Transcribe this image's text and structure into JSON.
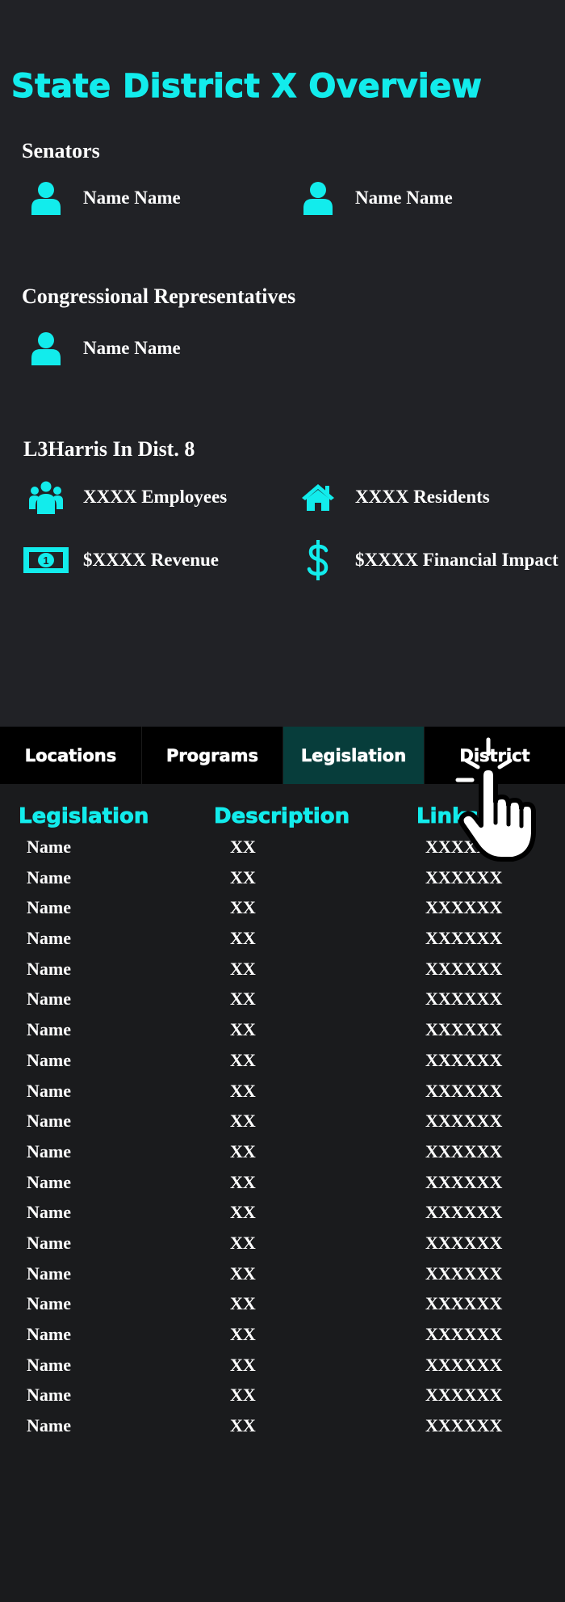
{
  "overview": {
    "title": "State District X Overview"
  },
  "senators": {
    "heading": "Senators",
    "members": [
      {
        "name": "Name Name",
        "icon": "user-icon"
      },
      {
        "name": "Name Name",
        "icon": "user-icon"
      }
    ]
  },
  "congress": {
    "heading": "Congressional Representatives",
    "members": [
      {
        "name": "Name Name",
        "icon": "user-icon"
      }
    ]
  },
  "company": {
    "heading": "L3Harris In Dist. 8",
    "stats": [
      {
        "label": "XXXX Employees",
        "icon": "users-icon"
      },
      {
        "label": "XXXX Residents",
        "icon": "home-icon"
      },
      {
        "label": "$XXXX Revenue",
        "icon": "money-bill-icon"
      },
      {
        "label": "$XXXX Financial Impact",
        "icon": "dollar-icon"
      }
    ]
  },
  "tabs": [
    {
      "label": "Locations",
      "active": false
    },
    {
      "label": "Programs",
      "active": false
    },
    {
      "label": "Legislation",
      "active": true
    },
    {
      "label": "District",
      "active": false
    }
  ],
  "legislation_table": {
    "headers": [
      "Legislation",
      "Description",
      "Links"
    ],
    "rows": [
      [
        "Name",
        "XX",
        "XXXXXX"
      ],
      [
        "Name",
        "XX",
        "XXXXXX"
      ],
      [
        "Name",
        "XX",
        "XXXXXX"
      ],
      [
        "Name",
        "XX",
        "XXXXXX"
      ],
      [
        "Name",
        "XX",
        "XXXXXX"
      ],
      [
        "Name",
        "XX",
        "XXXXXX"
      ],
      [
        "Name",
        "XX",
        "XXXXXX"
      ],
      [
        "Name",
        "XX",
        "XXXXXX"
      ],
      [
        "Name",
        "XX",
        "XXXXXX"
      ],
      [
        "Name",
        "XX",
        "XXXXXX"
      ],
      [
        "Name",
        "XX",
        "XXXXXX"
      ],
      [
        "Name",
        "XX",
        "XXXXXX"
      ],
      [
        "Name",
        "XX",
        "XXXXXX"
      ],
      [
        "Name",
        "XX",
        "XXXXXX"
      ],
      [
        "Name",
        "XX",
        "XXXXXX"
      ],
      [
        "Name",
        "XX",
        "XXXXXX"
      ],
      [
        "Name",
        "XX",
        "XXXXXX"
      ],
      [
        "Name",
        "XX",
        "XXXXXX"
      ],
      [
        "Name",
        "XX",
        "XXXXXX"
      ],
      [
        "Name",
        "XX",
        "XXXXXX"
      ]
    ]
  },
  "colors": {
    "accent": "#12ecec",
    "active_tab": "#073d3b",
    "panel": "#212226",
    "background": "#1a1b1d"
  },
  "cursor": {
    "icon": "pointer-hand-icon"
  }
}
